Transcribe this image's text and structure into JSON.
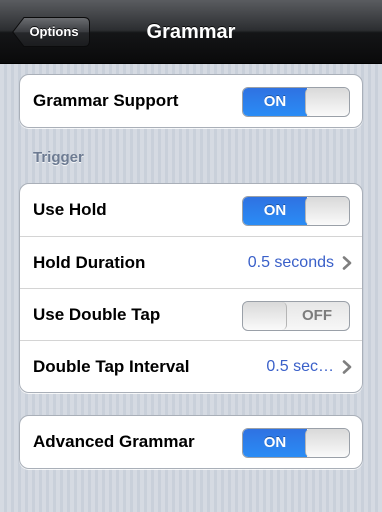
{
  "navbar": {
    "back_label": "Options",
    "title": "Grammar"
  },
  "groups": [
    {
      "rows": [
        {
          "label": "Grammar Support",
          "switch": "ON"
        }
      ]
    },
    {
      "header": "Trigger",
      "rows": [
        {
          "label": "Use Hold",
          "switch": "ON"
        },
        {
          "label": "Hold Duration",
          "value": "0.5 seconds"
        },
        {
          "label": "Use Double Tap",
          "switch": "OFF"
        },
        {
          "label": "Double Tap Interval",
          "value": "0.5 sec…"
        }
      ]
    },
    {
      "rows": [
        {
          "label": "Advanced Grammar",
          "switch": "ON"
        }
      ]
    }
  ],
  "colors": {
    "switch_on": "#2a8cf5",
    "value_text": "#3a60c9",
    "section_header": "#6d7b92"
  },
  "icons": {
    "chevron": "chevron-right-icon"
  }
}
